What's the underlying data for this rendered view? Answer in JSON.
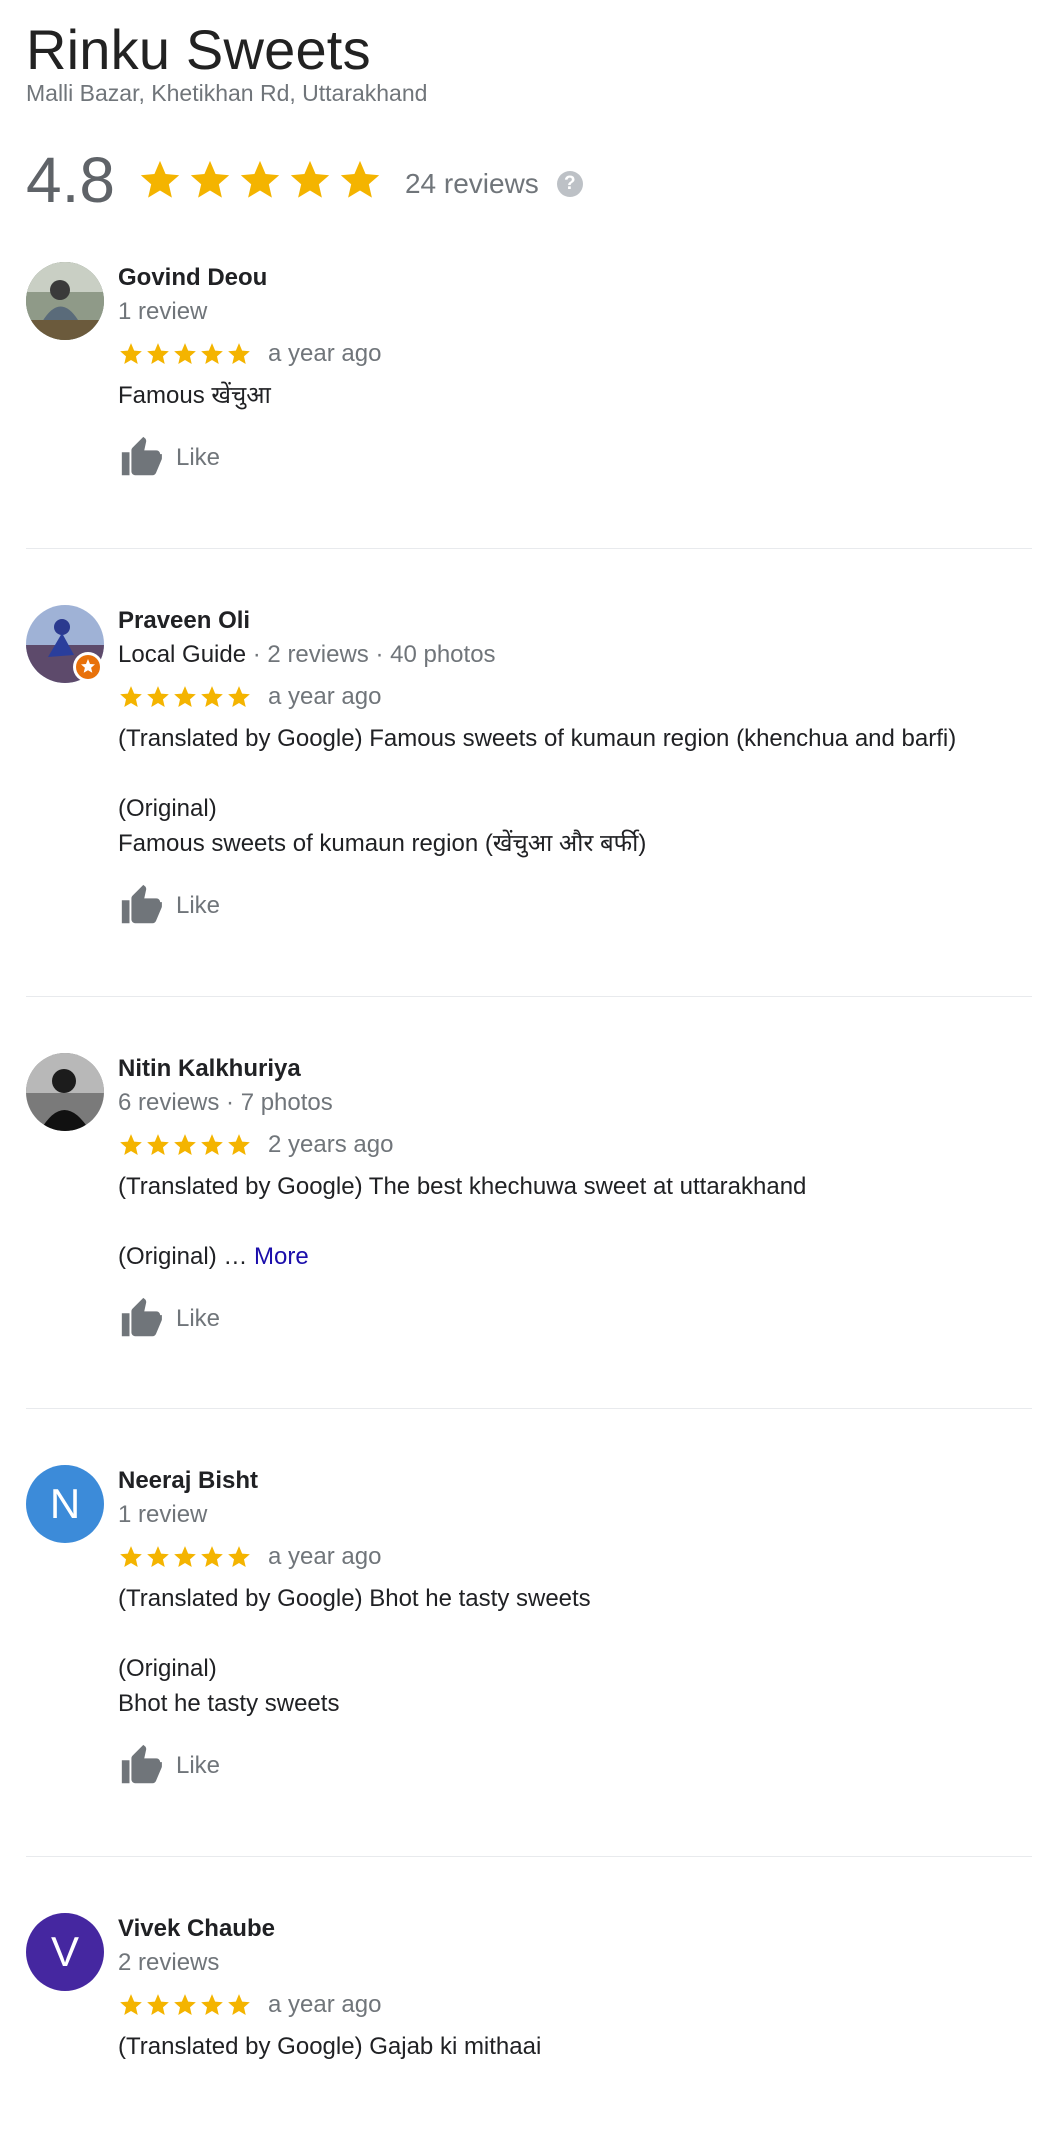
{
  "place": {
    "name": "Rinku Sweets",
    "address": "Malli Bazar, Khetikhan Rd, Uttarakhand",
    "rating": "4.8",
    "review_count": "24 reviews",
    "help_glyph": "?"
  },
  "colors": {
    "star": "#f4b400",
    "avatar_n": "#3c8bd9",
    "avatar_v": "#4527a0",
    "guide_badge": "#e8710a"
  },
  "reviews": [
    {
      "author": "Govind Deou",
      "meta_main": "",
      "meta": "1 review",
      "stars": 5,
      "time": "a year ago",
      "lines": [
        "Famous  खेंचुआ"
      ],
      "like": "Like"
    },
    {
      "author": "Praveen Oli",
      "meta_main": "Local Guide",
      "meta": " · 2 reviews · 40 photos",
      "stars": 5,
      "time": "a year ago",
      "lines": [
        "(Translated by Google) Famous sweets of kumaun region (khenchua and barfi)",
        "(Original)",
        "Famous sweets of kumaun region (खेंचुआ और बर्फी)"
      ],
      "like": "Like"
    },
    {
      "author": "Nitin Kalkhuriya",
      "meta_main": "",
      "meta": "6 reviews · 7 photos",
      "stars": 5,
      "time": "2 years ago",
      "lines": [
        "(Translated by Google) The best khechuwa sweet at uttarakhand",
        "(Original) … "
      ],
      "more": "More",
      "like": "Like"
    },
    {
      "author": "Neeraj Bisht",
      "avatar_letter": "N",
      "meta_main": "",
      "meta": "1 review",
      "stars": 5,
      "time": "a year ago",
      "lines": [
        "(Translated by Google) Bhot he tasty sweets",
        "(Original)",
        "Bhot he tasty sweets"
      ],
      "like": "Like"
    },
    {
      "author": "Vivek Chaube",
      "avatar_letter": "V",
      "meta_main": "",
      "meta": "2 reviews",
      "stars": 5,
      "time": "a year ago",
      "lines": [
        "(Translated by Google) Gajab ki mithaai"
      ]
    }
  ]
}
